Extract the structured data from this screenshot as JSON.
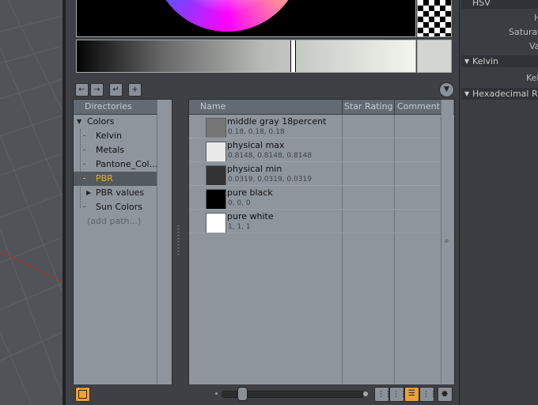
{
  "toolbar": {
    "back_icon": "back-arrow-icon",
    "forward_icon": "forward-arrow-icon",
    "up_icon": "up-directory-icon",
    "add_icon": "add-icon",
    "filter_icon": "filter-icon"
  },
  "directories": {
    "header": "Directories",
    "root": "Colors",
    "items": [
      {
        "label": "Kelvin",
        "selected": false,
        "expandable": false
      },
      {
        "label": "Metals",
        "selected": false,
        "expandable": false
      },
      {
        "label": "Pantone_Col…",
        "selected": false,
        "expandable": false
      },
      {
        "label": "PBR",
        "selected": true,
        "expandable": false
      },
      {
        "label": "PBR values",
        "selected": false,
        "expandable": true
      },
      {
        "label": "Sun Colors",
        "selected": false,
        "expandable": false
      }
    ],
    "add_path": "(add path...)"
  },
  "presets": {
    "columns": [
      "Name",
      "Star Rating",
      "Comment"
    ],
    "rows": [
      {
        "name": "middle gray 18percent",
        "value": "0.18, 0.18, 0.18",
        "color": "#767676"
      },
      {
        "name": "physical max",
        "value": "0.8148, 0.8148, 0.8148",
        "color": "#e9e9e9"
      },
      {
        "name": "physical min",
        "value": "0.0319, 0.0319, 0.0319",
        "color": "#333333"
      },
      {
        "name": "pure black",
        "value": "0, 0, 0",
        "color": "#000000"
      },
      {
        "name": "pure white",
        "value": "1, 1, 1",
        "color": "#ffffff"
      }
    ]
  },
  "properties": {
    "hsv_header": "HSV",
    "hue_label": "H",
    "saturation_label": "Saturat",
    "value_label": "Va",
    "kelvin_header": "Kelvin",
    "kelvin_label": "Kel",
    "hex_header": "Hexadecimal RGB"
  },
  "colors": {
    "accent": "#f0a030",
    "pane_bg": "#8e959d",
    "header_bg": "#626a73"
  }
}
